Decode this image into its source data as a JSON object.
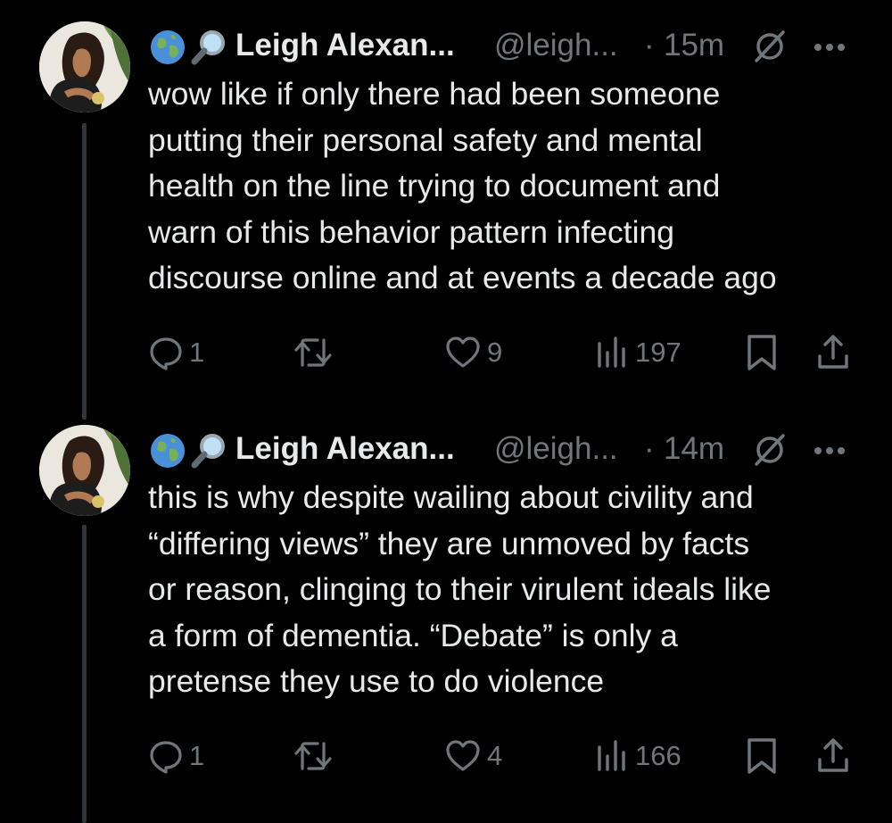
{
  "colors": {
    "background": "#000000",
    "text_primary": "#e7e9ea",
    "text_secondary": "#71767b",
    "thread_line": "#333639"
  },
  "tweets": [
    {
      "author_name": "Leigh Alexan...",
      "handle": "@leigh...",
      "separator": "·",
      "time": "15m",
      "name_emojis": [
        "globe-icon",
        "magnifier-icon"
      ],
      "text": "wow like if only there had been someone\nputting their personal safety and mental\nhealth on the line trying to document and\nwarn of this behavior pattern infecting\ndiscourse online and at events a decade ago",
      "replies": "1",
      "likes": "9",
      "views": "197"
    },
    {
      "author_name": "Leigh Alexan...",
      "handle": "@leigh...",
      "separator": "·",
      "time": "14m",
      "name_emojis": [
        "globe-icon",
        "magnifier-icon"
      ],
      "text": "this is why despite wailing about civility and\n“differing views” they are unmoved by facts\nor reason, clinging to their virulent ideals like\na form of dementia. “Debate” is only a\npretense they use to do violence",
      "replies": "1",
      "likes": "4",
      "views": "166"
    }
  ]
}
